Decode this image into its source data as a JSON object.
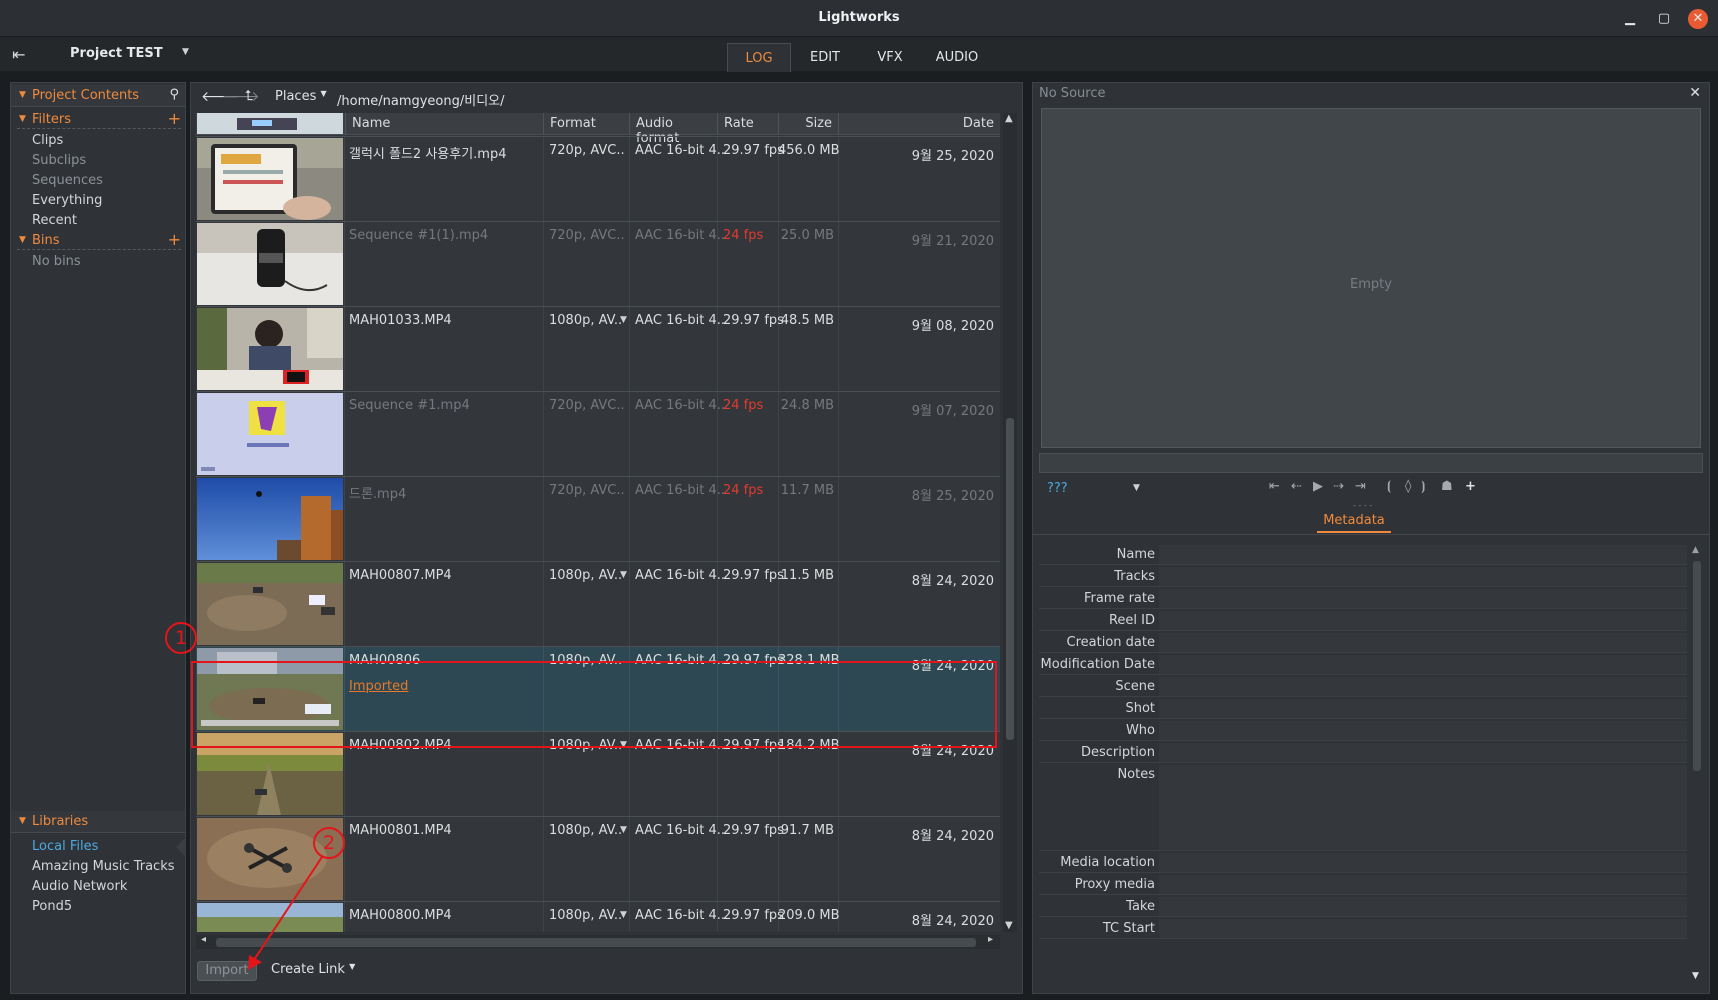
{
  "window": {
    "title": "Lightworks",
    "min": "▁",
    "max": "▢",
    "close": "✕"
  },
  "project": {
    "title": "Project TEST"
  },
  "tabs": [
    {
      "label": "LOG"
    },
    {
      "label": "EDIT"
    },
    {
      "label": "VFX"
    },
    {
      "label": "AUDIO"
    }
  ],
  "sidebar": {
    "header": "Project Contents",
    "filters_label": "Filters",
    "filters": [
      "Clips",
      "Subclips",
      "Sequences",
      "Everything",
      "Recent"
    ],
    "bins_label": "Bins",
    "no_bins": "No bins",
    "libraries_label": "Libraries",
    "libraries": [
      "Local Files",
      "Amazing Music Tracks",
      "Audio Network",
      "Pond5"
    ]
  },
  "browser": {
    "places": "Places",
    "path": "/home/namgyeong/비디오/",
    "columns": [
      "Name",
      "Format",
      "Audio format",
      "Rate",
      "Size",
      "Date"
    ],
    "rows": [
      {
        "name": "갤럭시 폴드2 사용후기.mp4",
        "format": "720p, AVC..",
        "audio": "AAC 16-bit 4..",
        "rate": "29.97 fps",
        "size": "456.0 MB",
        "date": "9월 25, 2020"
      },
      {
        "name": "Sequence #1(1).mp4",
        "format": "720p, AVC..",
        "audio": "AAC 16-bit 4..",
        "rate": "24 fps",
        "size": "25.0 MB",
        "date": "9월 21, 2020"
      },
      {
        "name": "MAH01033.MP4",
        "format": "1080p, AV..",
        "audio": "AAC 16-bit 4..",
        "rate": "29.97 fps",
        "size": "48.5 MB",
        "date": "9월 08, 2020"
      },
      {
        "name": "Sequence #1.mp4",
        "format": "720p, AVC..",
        "audio": "AAC 16-bit 4..",
        "rate": "24 fps",
        "size": "24.8 MB",
        "date": "9월 07, 2020"
      },
      {
        "name": "드론.mp4",
        "format": "720p, AVC..",
        "audio": "AAC 16-bit 4..",
        "rate": "24 fps",
        "size": "11.7 MB",
        "date": "8월 25, 2020"
      },
      {
        "name": "MAH00807.MP4",
        "format": "1080p, AV..",
        "audio": "AAC 16-bit 4..",
        "rate": "29.97 fps",
        "size": "11.5 MB",
        "date": "8월 24, 2020"
      },
      {
        "name": "MAH00806",
        "status": "Imported",
        "format": "1080p, AV..",
        "audio": "AAC 16-bit 4..",
        "rate": "29.97 fps",
        "size": "328.1 MB",
        "date": "8월 24, 2020"
      },
      {
        "name": "MAH00802.MP4",
        "format": "1080p, AV..",
        "audio": "AAC 16-bit 4..",
        "rate": "29.97 fps",
        "size": "184.2 MB",
        "date": "8월 24, 2020"
      },
      {
        "name": "MAH00801.MP4",
        "format": "1080p, AV..",
        "audio": "AAC 16-bit 4..",
        "rate": "29.97 fps",
        "size": "91.7 MB",
        "date": "8월 24, 2020"
      },
      {
        "name": "MAH00800.MP4",
        "format": "1080p, AV..",
        "audio": "AAC 16-bit 4..",
        "rate": "29.97 fps",
        "size": "209.0 MB",
        "date": "8월 24, 2020"
      }
    ],
    "import_label": "Import",
    "create_link_label": "Create Link"
  },
  "annotations": {
    "marker1": "1",
    "marker2": "2"
  },
  "source": {
    "title": "No Source",
    "empty": "Empty",
    "timecode_format": "???",
    "metadata_tab": "Metadata",
    "fields": [
      "Name",
      "Tracks",
      "Frame rate",
      "Reel ID",
      "Creation date",
      "Modification Date",
      "Scene",
      "Shot",
      "Who",
      "Description",
      "Notes",
      "Media location",
      "Proxy media",
      "Take",
      "TC Start"
    ]
  },
  "colors": {
    "accent": "#f08a3c",
    "link": "#4ea8e0",
    "warning": "#e33a2e",
    "annotation": "#e3151b"
  }
}
